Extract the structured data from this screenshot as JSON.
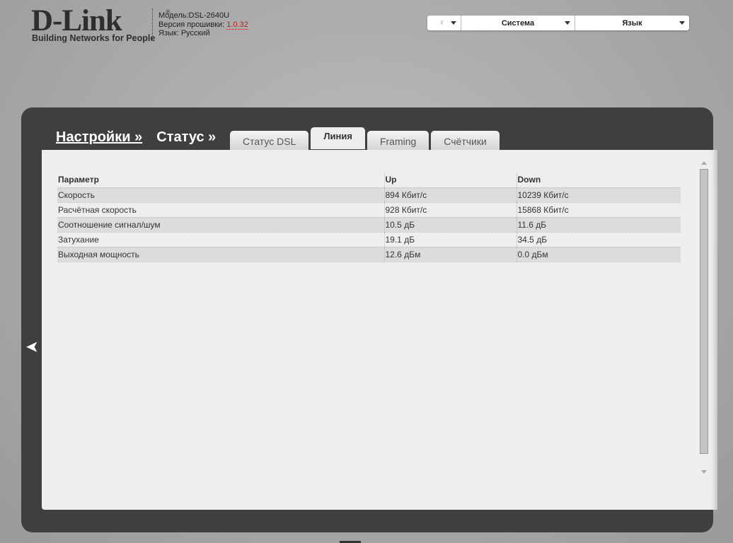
{
  "header": {
    "logo_text": "D-Link",
    "logo_tagline": "Building Networks for People",
    "model_label": "Модель:",
    "model": "DSL-2640U",
    "firmware_label": "Версия прошивки: ",
    "firmware": "1.0.32",
    "language_label": "Язык: ",
    "language": "Русский"
  },
  "topmenu": {
    "hint_icon": "lightbulb-icon",
    "system": "Система",
    "language": "Язык"
  },
  "breadcrumb": {
    "settings": "Настройки »",
    "status": "Статус »"
  },
  "tabs": [
    {
      "label": "Статус DSL"
    },
    {
      "label": "Линия",
      "active": true
    },
    {
      "label": "Framing"
    },
    {
      "label": "Счётчики"
    }
  ],
  "table": {
    "headers": [
      "Параметр",
      "Up",
      "Down"
    ],
    "rows": [
      [
        "Скорость",
        "894 Кбит/с",
        "10239 Кбит/с"
      ],
      [
        "Расчётная скорость",
        "928 Кбит/с",
        "15868 Кбит/с"
      ],
      [
        "Соотношение сигнал/шум",
        "10.5 дБ",
        "11.6 дБ"
      ],
      [
        "Затухание",
        "19.1 дБ",
        "34.5 дБ"
      ],
      [
        "Выходная мощность",
        "12.6 дБм",
        "0.0 дБм"
      ]
    ]
  }
}
